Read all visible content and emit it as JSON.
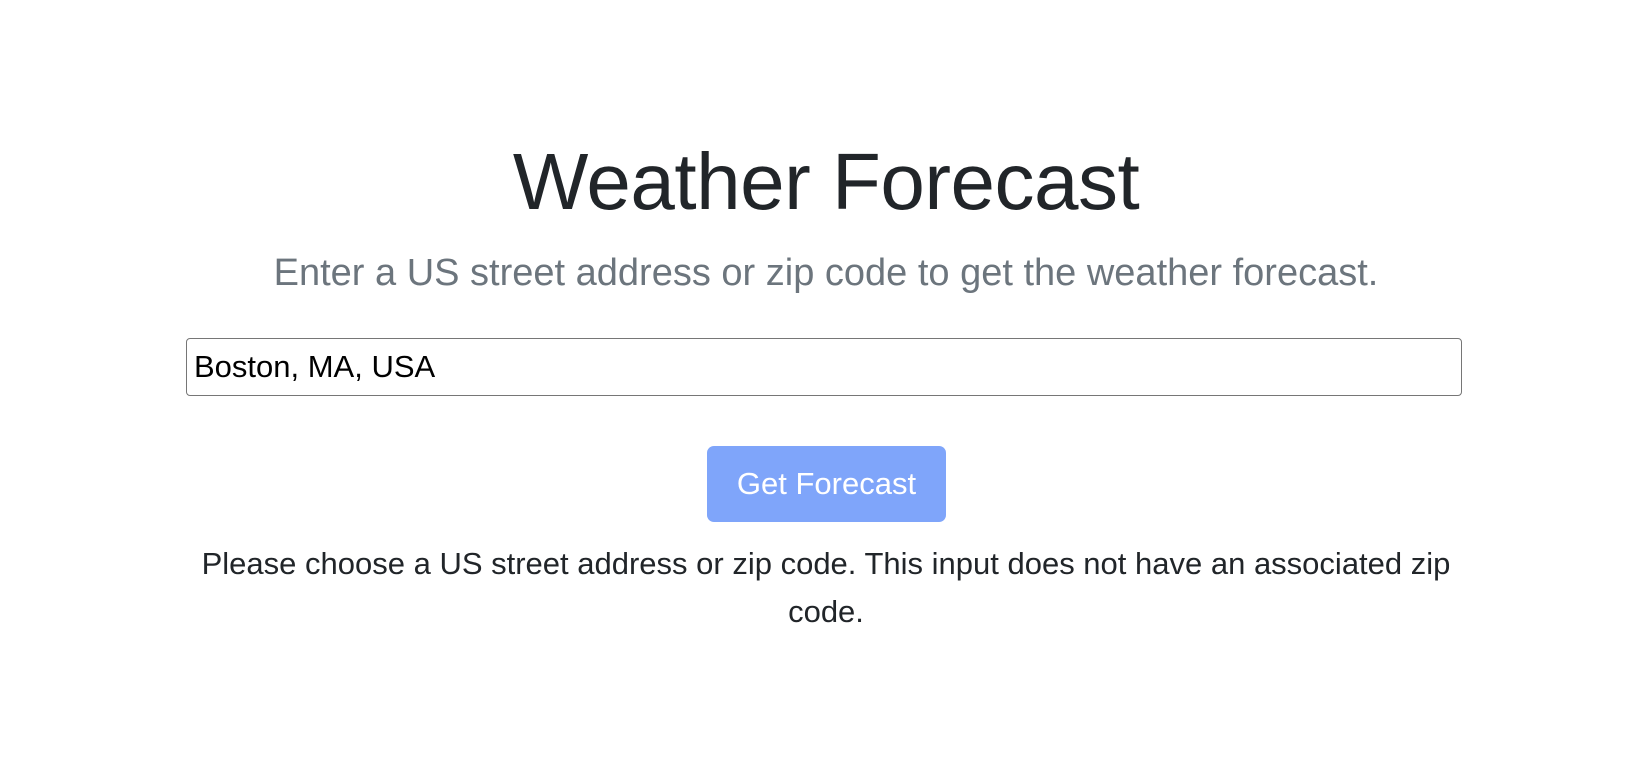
{
  "header": {
    "title": "Weather Forecast",
    "subtitle": "Enter a US street address or zip code to get the weather forecast."
  },
  "form": {
    "address_value": "Boston, MA, USA",
    "submit_label": "Get Forecast"
  },
  "status": {
    "message": "Please choose a US street address or zip code. This input does not have an associated zip code."
  },
  "colors": {
    "button_background": "#7fa5fa",
    "text_primary": "#212529",
    "text_muted": "#6c757d"
  }
}
